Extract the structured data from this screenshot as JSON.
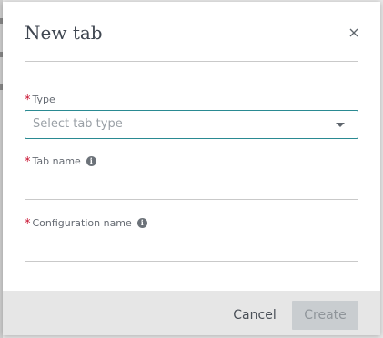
{
  "dialog": {
    "title": "New tab",
    "close_label": "×"
  },
  "fields": {
    "type": {
      "label": "Type",
      "required_mark": "*",
      "placeholder": "Select tab type",
      "value": ""
    },
    "tab_name": {
      "label": "Tab name",
      "required_mark": "*",
      "info_icon": "info-icon",
      "value": ""
    },
    "configuration_name": {
      "label": "Configuration name",
      "required_mark": "*",
      "info_icon": "info-icon",
      "value": ""
    }
  },
  "footer": {
    "cancel_label": "Cancel",
    "create_label": "Create",
    "create_disabled": true
  },
  "colors": {
    "accent": "#2a8a92",
    "required": "#c8102e",
    "footer_bg": "#e6e6e6",
    "disabled_button_bg": "#c9cdd0"
  }
}
